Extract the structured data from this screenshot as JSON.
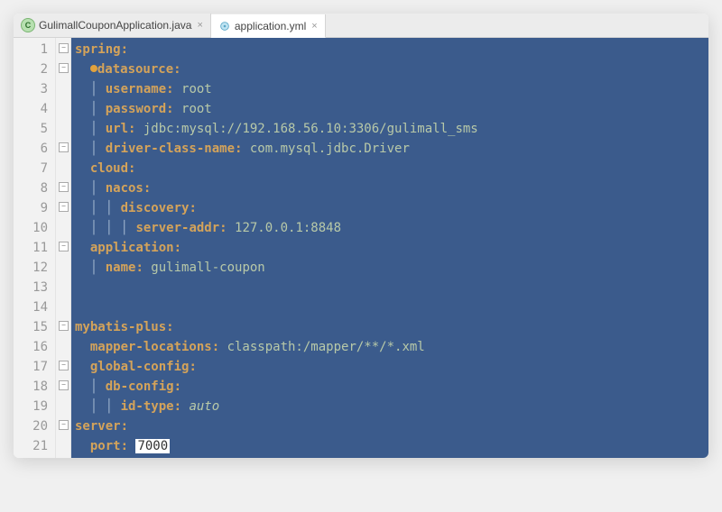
{
  "tabs": [
    {
      "label": "GulimallCouponApplication.java",
      "active": false,
      "icon": "class-icon"
    },
    {
      "label": "application.yml",
      "active": true,
      "icon": "yaml-icon"
    }
  ],
  "lines": {
    "n1": "1",
    "n2": "2",
    "n3": "3",
    "n4": "4",
    "n5": "5",
    "n6": "6",
    "n7": "7",
    "n8": "8",
    "n9": "9",
    "n10": "10",
    "n11": "11",
    "n12": "12",
    "n13": "13",
    "n14": "14",
    "n15": "15",
    "n16": "16",
    "n17": "17",
    "n18": "18",
    "n19": "19",
    "n20": "20",
    "n21": "21"
  },
  "yaml": {
    "spring": "spring",
    "datasource": "datasource",
    "username_k": "username",
    "username_v": "root",
    "password_k": "password",
    "password_v": "root",
    "url_k": "url",
    "url_v": "jdbc:mysql://192.168.56.10:3306/gulimall_sms",
    "driver_k": "driver-class-name",
    "driver_v": "com.mysql.jdbc.Driver",
    "cloud": "cloud",
    "nacos": "nacos",
    "discovery": "discovery",
    "server_addr_k": "server-addr",
    "server_addr_v": "127.0.0.1:8848",
    "application": "application",
    "name_k": "name",
    "name_v": "gulimall-coupon",
    "mybatis": "mybatis-plus",
    "mapper_k": "mapper-locations",
    "mapper_v": "classpath:/mapper/**/*.xml",
    "global_config": "global-config",
    "db_config": "db-config",
    "id_type_k": "id-type",
    "id_type_v": "auto",
    "server": "server",
    "port_k": "port",
    "port_v": "7000"
  },
  "closeGlyph": "×"
}
